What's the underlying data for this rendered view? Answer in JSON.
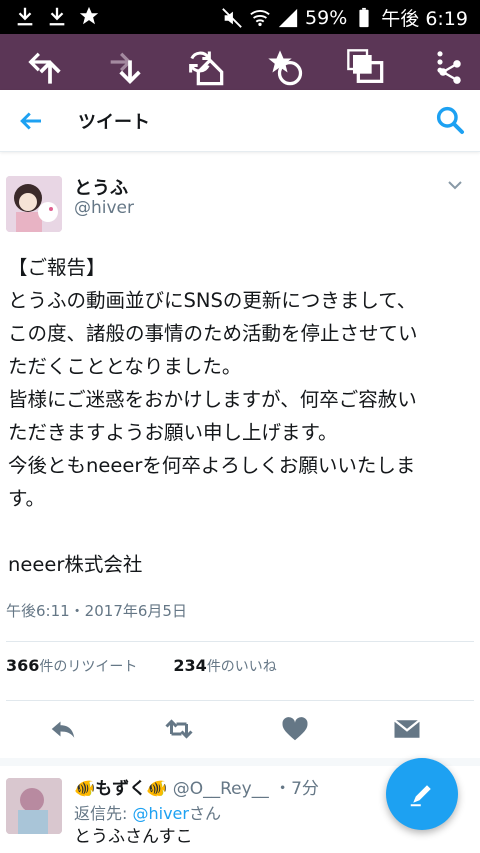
{
  "status_bar": {
    "battery": "59%",
    "time": "午後 6:19",
    "icons": [
      "download-icon",
      "download-icon",
      "star-icon",
      "mute-icon",
      "wifi-icon",
      "signal-icon",
      "battery-icon"
    ]
  },
  "browser_toolbar": {
    "buttons": [
      "back-arrow-icon",
      "forward-arrow-icon",
      "refresh-icon",
      "bookmark-star-icon",
      "tabs-icon",
      "menu-icon"
    ]
  },
  "header": {
    "title": "ツイート",
    "back_icon": "back-arrow-icon",
    "search_icon": "search-icon",
    "accent": "#1da1f2"
  },
  "tweet": {
    "author_name": "とうふ",
    "author_handle": "@hiver",
    "text": "【ご報告】\nとうふの動画並びにSNSの更新につきまして、\nこの度、諸般の事情のため活動を停止させてい\nただくこととなりました。\n皆様にご迷惑をおかけしますが、何卒ご容赦い\nただきますようお願い申し上げます。\n今後ともneeerを何卒よろしくお願いいたしま\nす。\n\nneeer株式会社",
    "timestamp": "午後6:11・2017年6月5日",
    "retweet_count": "366",
    "retweet_label": "件のリツイート",
    "like_count": "234",
    "like_label": "件のいいね"
  },
  "reply": {
    "name": "🐠もずく🐠",
    "handle": "@O__Rey__",
    "time": "・7分",
    "replying_prefix": "返信先: ",
    "replying_to": "@hiver",
    "replying_suffix": "さん",
    "text": "とうふさんすこ"
  },
  "colors": {
    "toolbar": "#5b3656",
    "link": "#1da1f2",
    "muted": "#657786"
  }
}
